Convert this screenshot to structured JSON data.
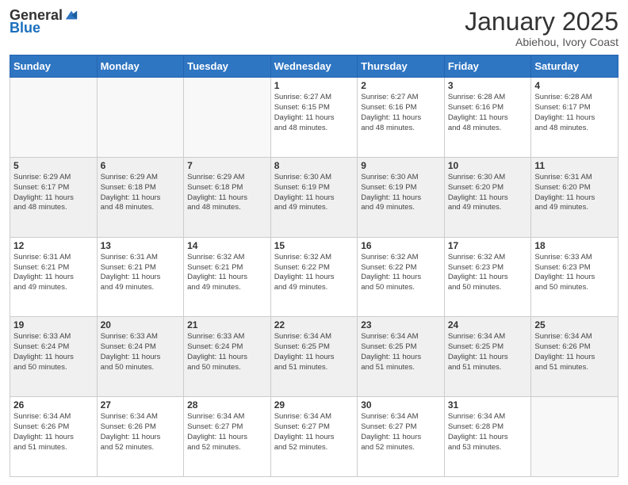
{
  "header": {
    "logo_general": "General",
    "logo_blue": "Blue",
    "title": "January 2025",
    "location": "Abiehou, Ivory Coast"
  },
  "weekdays": [
    "Sunday",
    "Monday",
    "Tuesday",
    "Wednesday",
    "Thursday",
    "Friday",
    "Saturday"
  ],
  "weeks": [
    [
      {
        "day": "",
        "info": ""
      },
      {
        "day": "",
        "info": ""
      },
      {
        "day": "",
        "info": ""
      },
      {
        "day": "1",
        "info": "Sunrise: 6:27 AM\nSunset: 6:15 PM\nDaylight: 11 hours\nand 48 minutes."
      },
      {
        "day": "2",
        "info": "Sunrise: 6:27 AM\nSunset: 6:16 PM\nDaylight: 11 hours\nand 48 minutes."
      },
      {
        "day": "3",
        "info": "Sunrise: 6:28 AM\nSunset: 6:16 PM\nDaylight: 11 hours\nand 48 minutes."
      },
      {
        "day": "4",
        "info": "Sunrise: 6:28 AM\nSunset: 6:17 PM\nDaylight: 11 hours\nand 48 minutes."
      }
    ],
    [
      {
        "day": "5",
        "info": "Sunrise: 6:29 AM\nSunset: 6:17 PM\nDaylight: 11 hours\nand 48 minutes."
      },
      {
        "day": "6",
        "info": "Sunrise: 6:29 AM\nSunset: 6:18 PM\nDaylight: 11 hours\nand 48 minutes."
      },
      {
        "day": "7",
        "info": "Sunrise: 6:29 AM\nSunset: 6:18 PM\nDaylight: 11 hours\nand 48 minutes."
      },
      {
        "day": "8",
        "info": "Sunrise: 6:30 AM\nSunset: 6:19 PM\nDaylight: 11 hours\nand 49 minutes."
      },
      {
        "day": "9",
        "info": "Sunrise: 6:30 AM\nSunset: 6:19 PM\nDaylight: 11 hours\nand 49 minutes."
      },
      {
        "day": "10",
        "info": "Sunrise: 6:30 AM\nSunset: 6:20 PM\nDaylight: 11 hours\nand 49 minutes."
      },
      {
        "day": "11",
        "info": "Sunrise: 6:31 AM\nSunset: 6:20 PM\nDaylight: 11 hours\nand 49 minutes."
      }
    ],
    [
      {
        "day": "12",
        "info": "Sunrise: 6:31 AM\nSunset: 6:21 PM\nDaylight: 11 hours\nand 49 minutes."
      },
      {
        "day": "13",
        "info": "Sunrise: 6:31 AM\nSunset: 6:21 PM\nDaylight: 11 hours\nand 49 minutes."
      },
      {
        "day": "14",
        "info": "Sunrise: 6:32 AM\nSunset: 6:21 PM\nDaylight: 11 hours\nand 49 minutes."
      },
      {
        "day": "15",
        "info": "Sunrise: 6:32 AM\nSunset: 6:22 PM\nDaylight: 11 hours\nand 49 minutes."
      },
      {
        "day": "16",
        "info": "Sunrise: 6:32 AM\nSunset: 6:22 PM\nDaylight: 11 hours\nand 50 minutes."
      },
      {
        "day": "17",
        "info": "Sunrise: 6:32 AM\nSunset: 6:23 PM\nDaylight: 11 hours\nand 50 minutes."
      },
      {
        "day": "18",
        "info": "Sunrise: 6:33 AM\nSunset: 6:23 PM\nDaylight: 11 hours\nand 50 minutes."
      }
    ],
    [
      {
        "day": "19",
        "info": "Sunrise: 6:33 AM\nSunset: 6:24 PM\nDaylight: 11 hours\nand 50 minutes."
      },
      {
        "day": "20",
        "info": "Sunrise: 6:33 AM\nSunset: 6:24 PM\nDaylight: 11 hours\nand 50 minutes."
      },
      {
        "day": "21",
        "info": "Sunrise: 6:33 AM\nSunset: 6:24 PM\nDaylight: 11 hours\nand 50 minutes."
      },
      {
        "day": "22",
        "info": "Sunrise: 6:34 AM\nSunset: 6:25 PM\nDaylight: 11 hours\nand 51 minutes."
      },
      {
        "day": "23",
        "info": "Sunrise: 6:34 AM\nSunset: 6:25 PM\nDaylight: 11 hours\nand 51 minutes."
      },
      {
        "day": "24",
        "info": "Sunrise: 6:34 AM\nSunset: 6:25 PM\nDaylight: 11 hours\nand 51 minutes."
      },
      {
        "day": "25",
        "info": "Sunrise: 6:34 AM\nSunset: 6:26 PM\nDaylight: 11 hours\nand 51 minutes."
      }
    ],
    [
      {
        "day": "26",
        "info": "Sunrise: 6:34 AM\nSunset: 6:26 PM\nDaylight: 11 hours\nand 51 minutes."
      },
      {
        "day": "27",
        "info": "Sunrise: 6:34 AM\nSunset: 6:26 PM\nDaylight: 11 hours\nand 52 minutes."
      },
      {
        "day": "28",
        "info": "Sunrise: 6:34 AM\nSunset: 6:27 PM\nDaylight: 11 hours\nand 52 minutes."
      },
      {
        "day": "29",
        "info": "Sunrise: 6:34 AM\nSunset: 6:27 PM\nDaylight: 11 hours\nand 52 minutes."
      },
      {
        "day": "30",
        "info": "Sunrise: 6:34 AM\nSunset: 6:27 PM\nDaylight: 11 hours\nand 52 minutes."
      },
      {
        "day": "31",
        "info": "Sunrise: 6:34 AM\nSunset: 6:28 PM\nDaylight: 11 hours\nand 53 minutes."
      },
      {
        "day": "",
        "info": ""
      }
    ]
  ]
}
